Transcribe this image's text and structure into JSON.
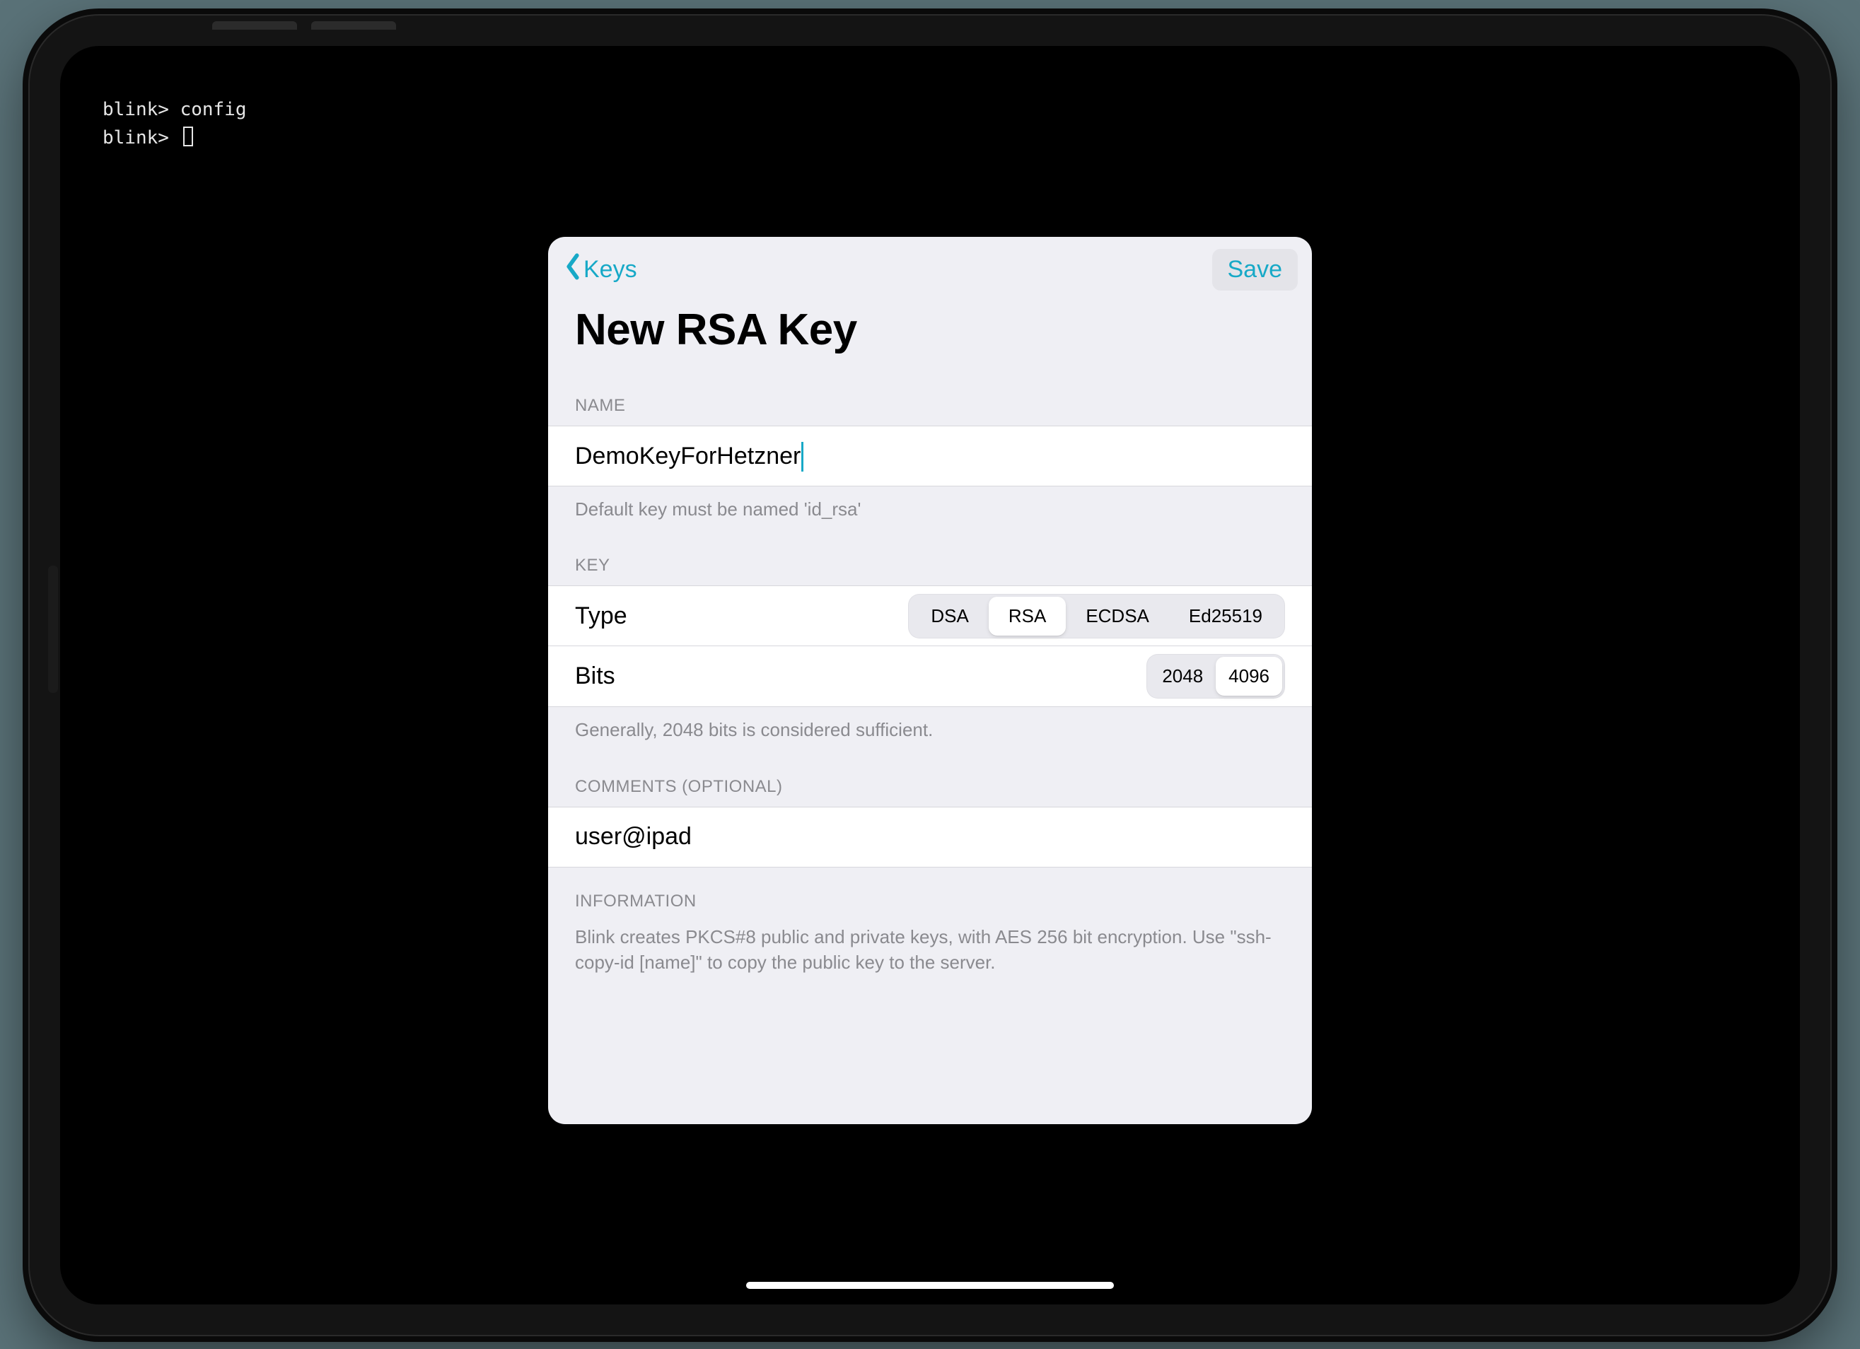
{
  "terminal": {
    "prompt": "blink>",
    "lines": [
      "config",
      ""
    ]
  },
  "nav": {
    "back_label": "Keys",
    "save_label": "Save"
  },
  "title": "New RSA Key",
  "sections": {
    "name": {
      "header": "NAME",
      "value": "DemoKeyForHetzner",
      "hint": "Default key must be named 'id_rsa'"
    },
    "key": {
      "header": "KEY",
      "type_label": "Type",
      "type_options": [
        "DSA",
        "RSA",
        "ECDSA",
        "Ed25519"
      ],
      "type_selected": "RSA",
      "bits_label": "Bits",
      "bits_options": [
        "2048",
        "4096"
      ],
      "bits_selected": "4096",
      "hint": "Generally, 2048 bits is considered sufficient."
    },
    "comments": {
      "header": "COMMENTS (OPTIONAL)",
      "value": "user@ipad"
    },
    "information": {
      "header": "INFORMATION",
      "text": "Blink creates PKCS#8 public and private keys, with AES 256 bit encryption. Use \"ssh-copy-id [name]\" to copy the public key to the server."
    }
  },
  "colors": {
    "accent": "#17a9c7",
    "sheet_bg": "#efeff4",
    "page_bg": "#5a7278"
  }
}
